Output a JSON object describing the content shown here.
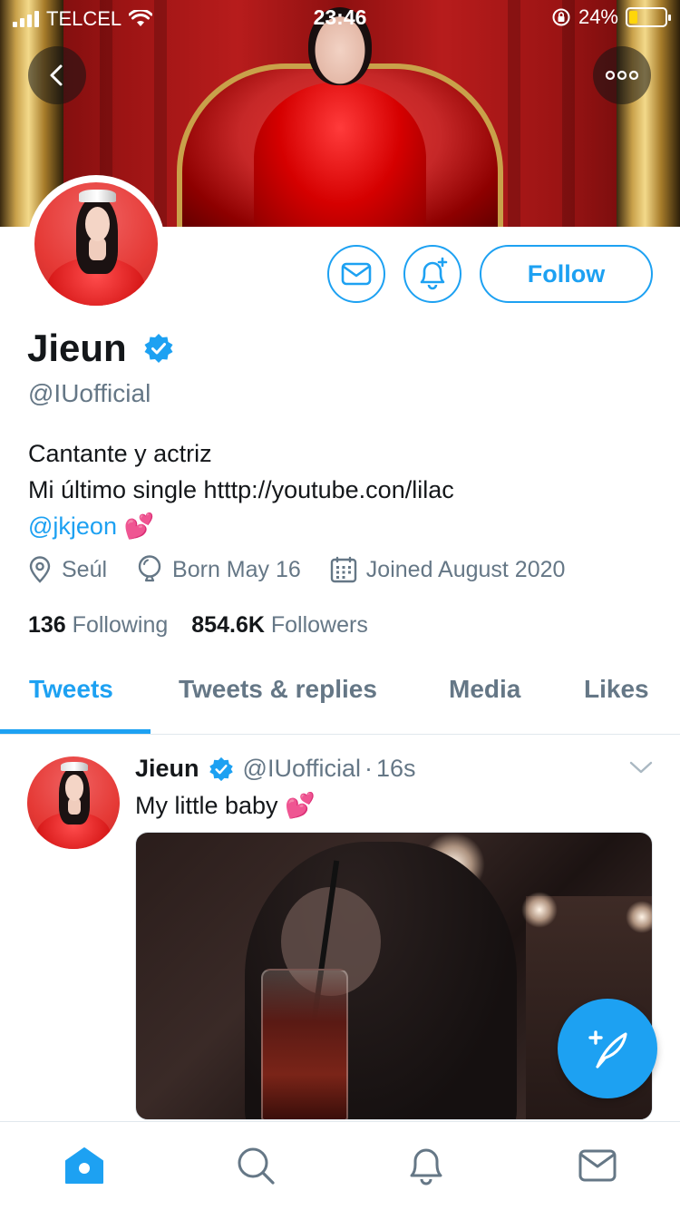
{
  "status_bar": {
    "carrier": "TELCEL",
    "time": "23:46",
    "battery": "24%",
    "battery_level": 0.24
  },
  "profile": {
    "display_name": "Jieun",
    "handle": "@IUofficial",
    "verified": true,
    "bio_line1": "Cantante y actriz",
    "bio_line2": "Mi último single htttp://youtube.con/lilac",
    "bio_mention": "@jkjeon",
    "bio_emoji": "💕",
    "location": "Seúl",
    "birthday": "Born May 16",
    "joined": "Joined August 2020",
    "following_count": "136",
    "following_label": "Following",
    "followers_count": "854.6K",
    "followers_label": "Followers"
  },
  "actions": {
    "follow_label": "Follow"
  },
  "tabs": [
    {
      "label": "Tweets",
      "active": true
    },
    {
      "label": "Tweets & replies",
      "active": false
    },
    {
      "label": "Media",
      "active": false
    },
    {
      "label": "Likes",
      "active": false
    }
  ],
  "tweet": {
    "name": "Jieun",
    "handle": "@IUofficial",
    "separator": "·",
    "time": "16s",
    "text": "My little baby 💕"
  },
  "colors": {
    "accent": "#1da1f2",
    "text_primary": "#14171a",
    "text_secondary": "#657786",
    "verified": "#1da1f2"
  },
  "icons": {
    "back": "chevron-left-icon",
    "more": "more-horizontal-icon",
    "message": "envelope-icon",
    "notify": "bell-plus-icon",
    "location": "location-pin-icon",
    "birthday": "balloon-icon",
    "calendar": "calendar-icon",
    "compose": "compose-quill-icon",
    "nav_home": "home-icon",
    "nav_search": "search-icon",
    "nav_notifications": "bell-icon",
    "nav_messages": "envelope-icon"
  }
}
